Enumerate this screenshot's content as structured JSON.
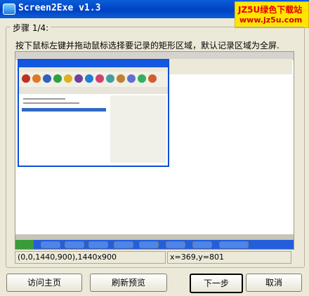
{
  "window": {
    "title": "Screen2Exe v1.3"
  },
  "watermark": {
    "line1": "JZ5U绿色下载站",
    "line2": "www.jz5u.com"
  },
  "step": {
    "label": "步骤 1/4:",
    "instruction": "按下鼠标左键并拖动鼠标选择要记录的矩形区域，默认记录区域为全屏."
  },
  "status": {
    "region": "(0,0,1440,900),1440x900",
    "cursor": "x=369,y=801"
  },
  "buttons": {
    "homepage": "访问主页",
    "refresh": "刷新预览",
    "next": "下一步",
    "cancel": "取消"
  },
  "preview": {
    "toolbar_icon_colors": [
      "#c03020",
      "#e07820",
      "#3060c0",
      "#30a040",
      "#e0b020",
      "#7040a0",
      "#2080d0",
      "#d04070",
      "#40a0a0",
      "#c08030",
      "#6070d0",
      "#30b060",
      "#d06030"
    ]
  }
}
